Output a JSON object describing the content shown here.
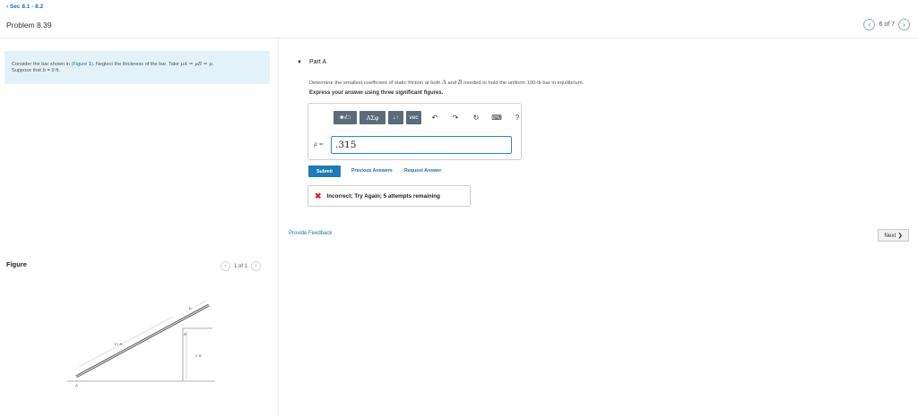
{
  "header": {
    "breadcrumb": "‹ Sec 8.1 - 8.2",
    "title": "Problem 8.39",
    "pager_text": "6 of 7",
    "prev_icon": "chevron-left-icon",
    "next_icon": "chevron-right-icon"
  },
  "problem": {
    "text_before_link": "Consider the bar shown in ",
    "link": "(Figure 1)",
    "text_after_link": ". Neglect the thickness of the bar. Take ",
    "mu_expr": "μA = μB = μ.",
    "line2_prefix": "Suppose that ",
    "b_expr": "b",
    "line2_suffix": " = 9  ft."
  },
  "figure": {
    "label": "Figure",
    "pager_text": "1 of 1",
    "length_label": "13 ft",
    "height_label": "5 ft",
    "b_label": "b",
    "point_a": "A",
    "point_b": "B"
  },
  "part": {
    "title": "Part A",
    "question_prefix": "Determine the smallest coefficient of static friction at both ",
    "question_a": "A",
    "question_mid": " and ",
    "question_b": "B",
    "question_suffix": " needed to hold the uniform 100-lb bar in equilibrium.",
    "instruction": "Express your answer using three significant figures."
  },
  "toolbar": {
    "sqrt_label": "■√□",
    "greek_label": "ΑΣφ",
    "arrows_label": "↓↑",
    "vec_label": "vec",
    "undo_icon": "↶",
    "redo_icon": "↷",
    "reset_icon": "↻",
    "keyboard_icon": "⌨",
    "help_icon": "?"
  },
  "answer": {
    "variable": "μ =",
    "value": ".315"
  },
  "actions": {
    "submit": "Submit",
    "previous_answers": "Previous Answers",
    "request_answer": "Request Answer"
  },
  "feedback": {
    "icon": "✖",
    "message": "Incorrect; Try Again; 5 attempts remaining"
  },
  "footer": {
    "provide_feedback": "Provide Feedback",
    "next": "Next",
    "next_icon": "❯"
  },
  "colors": {
    "link": "#1f6fa8",
    "submit_bg": "#1e7bb6",
    "problem_bg": "#e3f2f8",
    "error": "#d32a2a",
    "toolbar_bg": "#5b6b7a"
  }
}
